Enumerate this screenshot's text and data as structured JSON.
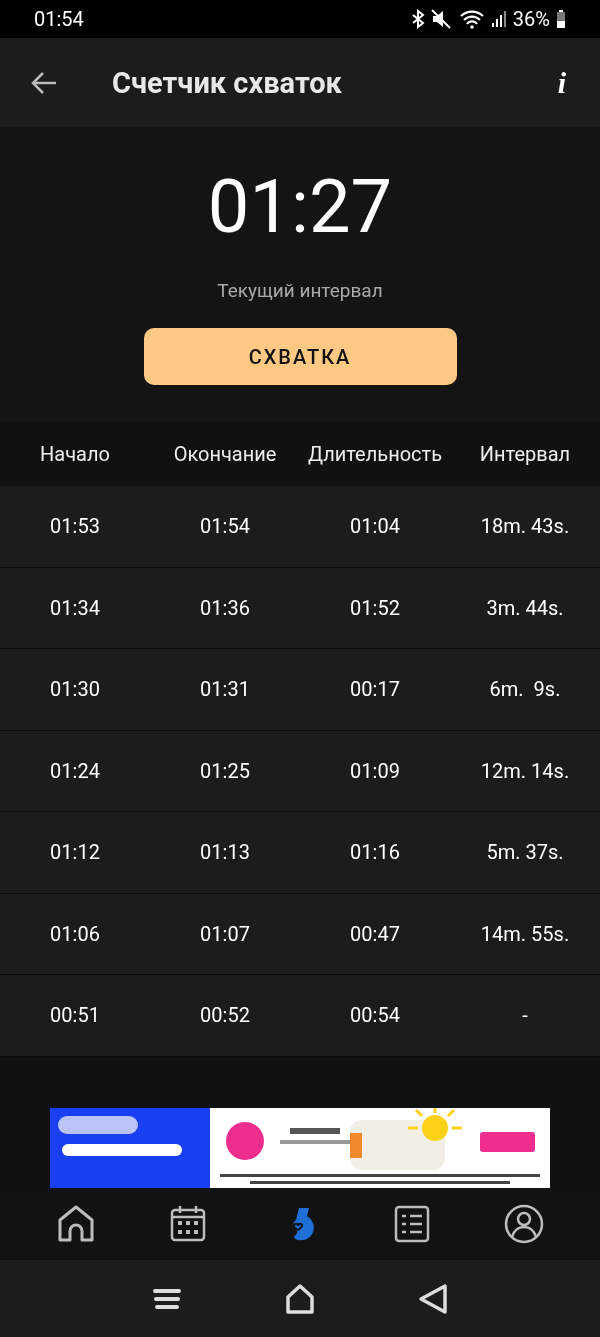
{
  "status_bar": {
    "time": "01:54",
    "battery": "36%"
  },
  "app_bar": {
    "title": "Счетчик схваток",
    "info": "i"
  },
  "timer": {
    "value": "01:27",
    "caption": "Текущий интервал",
    "button": "СХВАТКА"
  },
  "table": {
    "columns": [
      "Начало",
      "Окончание",
      "Длительность",
      "Интервал"
    ],
    "rows": [
      [
        "01:53",
        "01:54",
        "01:04",
        "18m. 43s."
      ],
      [
        "01:34",
        "01:36",
        "01:52",
        "3m. 44s."
      ],
      [
        "01:30",
        "01:31",
        "00:17",
        "6m.  9s."
      ],
      [
        "01:24",
        "01:25",
        "01:09",
        "12m. 14s."
      ],
      [
        "01:12",
        "01:13",
        "01:16",
        "5m. 37s."
      ],
      [
        "01:06",
        "01:07",
        "00:47",
        "14m. 55s."
      ],
      [
        "00:51",
        "00:52",
        "00:54",
        "-"
      ]
    ]
  },
  "bottom_nav": [
    {
      "kind": "home",
      "selected": false
    },
    {
      "kind": "calendar",
      "selected": false
    },
    {
      "kind": "pregnancy",
      "selected": true
    },
    {
      "kind": "list",
      "selected": false
    },
    {
      "kind": "profile",
      "selected": false
    }
  ]
}
